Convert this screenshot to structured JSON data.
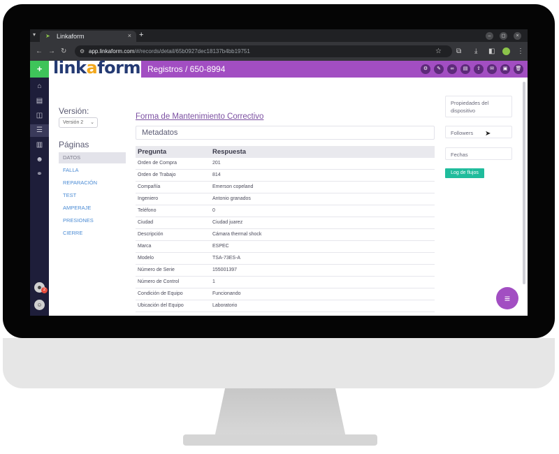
{
  "browser": {
    "tab_title": "Linkaform",
    "url_host": "app.linkaform.com",
    "url_path": "/#/records/detail/65b0927dec18137b4bb19751"
  },
  "header": {
    "plus": "+",
    "logo_left": "link",
    "logo_accent": "a",
    "logo_right": "form",
    "title": "Registros / 650-8994",
    "icons": [
      "gear-icon",
      "pencil-icon",
      "binoculars-icon",
      "file-icon",
      "upload-icon",
      "email-icon",
      "archive-icon",
      "trash-icon"
    ]
  },
  "leftnav": {
    "icons": [
      "home-icon",
      "document-icon",
      "layers-icon",
      "list-icon",
      "chart-icon",
      "users-icon",
      "link-icon"
    ],
    "notification_count": "2"
  },
  "version": {
    "label": "Versión:",
    "selected": "Versión 2"
  },
  "pages": {
    "label": "Páginas",
    "items": [
      {
        "label": "DATOS"
      },
      {
        "label": "FALLA"
      },
      {
        "label": "REPARACIÓN"
      },
      {
        "label": "TEST"
      },
      {
        "label": "AMPERAJE"
      },
      {
        "label": "PRESIONES"
      },
      {
        "label": "CIERRE"
      }
    ]
  },
  "form": {
    "title": "Forma de Mantenimiento Correctivo",
    "section": "Metadatos",
    "headers": {
      "question": "Pregunta",
      "answer": "Respuesta"
    },
    "rows": [
      {
        "q": "Orden de Compra",
        "a": "201"
      },
      {
        "q": "Orden de Trabajo",
        "a": "814"
      },
      {
        "q": "Compañía",
        "a": "Emerson copeland"
      },
      {
        "q": "Ingeniero",
        "a": "Antonio granados"
      },
      {
        "q": "Teléfono",
        "a": "0"
      },
      {
        "q": "Ciudad",
        "a": "Ciudad juarez"
      },
      {
        "q": "Descripción",
        "a": "Cámara thermal shock"
      },
      {
        "q": "Marca",
        "a": "ESPEC"
      },
      {
        "q": "Modelo",
        "a": "TSA-73ES-A"
      },
      {
        "q": "Número de Serie",
        "a": "155001397"
      },
      {
        "q": "Número de Control",
        "a": "1"
      },
      {
        "q": "Condición de Equipo",
        "a": "Funcionando"
      },
      {
        "q": "Ubicación del Equipo",
        "a": "Laboratorio"
      }
    ]
  },
  "sidebar": {
    "device_props": "Propiedades del dispositivo",
    "followers": "Followers",
    "dates": "Fechas",
    "log_button": "Log de flujos"
  },
  "colors": {
    "header_purple": "#a24ec2",
    "plus_green": "#3ec45a",
    "log_teal": "#1fbc9c",
    "nav_dark": "#1e1e3a"
  }
}
